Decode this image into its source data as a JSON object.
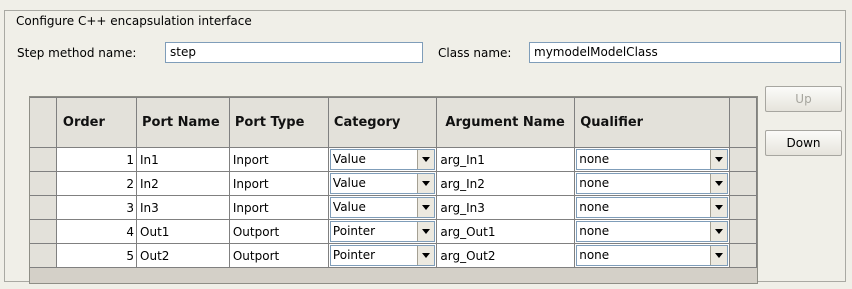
{
  "group": {
    "title": "Configure C++ encapsulation interface"
  },
  "step_method": {
    "label": "Step method name:",
    "value": "step"
  },
  "class_name": {
    "label": "Class name:",
    "value": "mymodelModelClass"
  },
  "table": {
    "headers": {
      "order": "Order",
      "port_name": "Port Name",
      "port_type": "Port Type",
      "category": "Category",
      "argument_name": "Argument Name",
      "qualifier": "Qualifier"
    },
    "rows": [
      {
        "order": "1",
        "port_name": "In1",
        "port_type": "Inport",
        "category": "Value",
        "argument_name": "arg_In1",
        "qualifier": "none"
      },
      {
        "order": "2",
        "port_name": "In2",
        "port_type": "Inport",
        "category": "Value",
        "argument_name": "arg_In2",
        "qualifier": "none"
      },
      {
        "order": "3",
        "port_name": "In3",
        "port_type": "Inport",
        "category": "Value",
        "argument_name": "arg_In3",
        "qualifier": "none"
      },
      {
        "order": "4",
        "port_name": "Out1",
        "port_type": "Outport",
        "category": "Pointer",
        "argument_name": "arg_Out1",
        "qualifier": "none"
      },
      {
        "order": "5",
        "port_name": "Out2",
        "port_type": "Outport",
        "category": "Pointer",
        "argument_name": "arg_Out2",
        "qualifier": "none"
      }
    ]
  },
  "buttons": {
    "up": {
      "label": "Up",
      "enabled": false
    },
    "down": {
      "label": "Down",
      "enabled": true
    }
  },
  "icons": {
    "dropdown": "chevron-down-icon"
  }
}
